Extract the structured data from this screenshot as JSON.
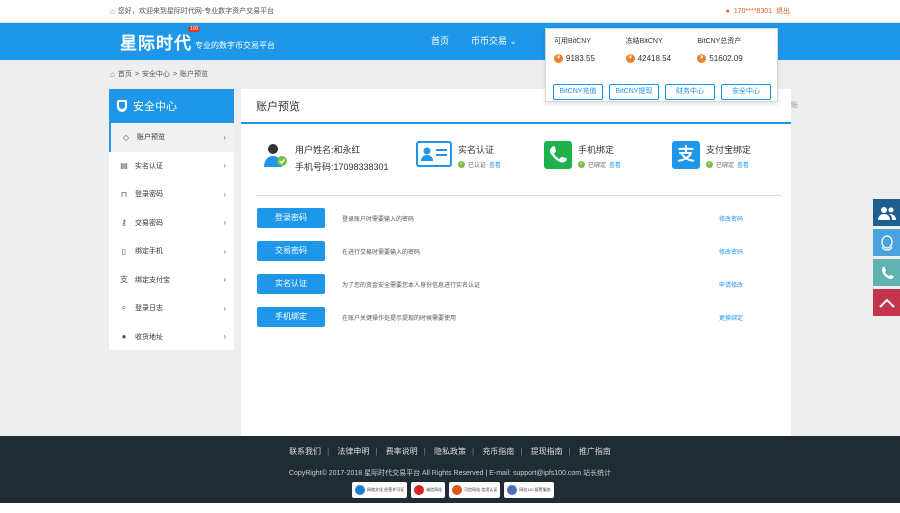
{
  "topbar": {
    "welcome": "您好，欢迎来到星际时代网-专业数字资产交易平台",
    "phone": "170****8301",
    "logout": "退出"
  },
  "header": {
    "logo_name": "星际时代",
    "logo_badge": "100",
    "logo_slogan": "专业的数字币交易平台",
    "nav": [
      {
        "label": "首页"
      },
      {
        "label": "币币交易 ⌄"
      }
    ]
  },
  "balance_dropdown": {
    "columns": [
      {
        "label": "可用BitCNY",
        "value": "9183.55"
      },
      {
        "label": "冻结BitCNY",
        "value": "42418.54"
      },
      {
        "label": "BitCNY总资产",
        "value": "51602.09"
      }
    ],
    "buttons": [
      {
        "label": "BitCNY充值"
      },
      {
        "label": "BitCNY提现"
      },
      {
        "label": "财务中心"
      },
      {
        "label": "安全中心"
      }
    ]
  },
  "breadcrumb": {
    "home": "首页",
    "sep": ">",
    "section": "安全中心",
    "page": "账户预览"
  },
  "sidebar": {
    "title": "安全中心",
    "items": [
      {
        "label": "账户预览",
        "icon": "diamond-icon"
      },
      {
        "label": "实名认证",
        "icon": "id-card-icon"
      },
      {
        "label": "登录密码",
        "icon": "lock-icon"
      },
      {
        "label": "交易密码",
        "icon": "key-icon"
      },
      {
        "label": "绑定手机",
        "icon": "phone-icon"
      },
      {
        "label": "绑定支付宝",
        "icon": "alipay-icon"
      },
      {
        "label": "登录日志",
        "icon": "search-icon"
      },
      {
        "label": "收货地址",
        "icon": "globe-icon"
      }
    ]
  },
  "main": {
    "title": "账户预览",
    "user_name": "用户姓名:和永红",
    "user_phone": "手机号码:17098338301",
    "cards": [
      {
        "title": "实名认证",
        "status": "已认证",
        "view": "查看"
      },
      {
        "title": "手机绑定",
        "status": "已绑定",
        "view": "查看"
      },
      {
        "title": "支付宝绑定",
        "status": "已绑定",
        "view": "查看"
      }
    ],
    "rows": [
      {
        "button": "登录密码",
        "desc": "登录账户时需要输入的密码",
        "link": "修改密码"
      },
      {
        "button": "交易密码",
        "desc": "在进行交易时需要输入的密码",
        "link": "修改密码"
      },
      {
        "button": "实名认证",
        "desc": "为了您的资金安全需要您本人身份信息进行实名认证",
        "link": "申请修改"
      },
      {
        "button": "手机绑定",
        "desc": "在账户关键操作处提示提现的时候需要使用",
        "link": "更换绑定"
      }
    ],
    "edge_text": "账"
  },
  "footer": {
    "links": [
      "联系我们",
      "法律申明",
      "费率说明",
      "隐私政策",
      "充币指南",
      "提现指南",
      "推广指南"
    ],
    "copyright": "CopyRight© 2017-2018 星际时代交易平台 All Rights Reserved | E-mail: support@ipfs100.com 站长统计",
    "badges": [
      {
        "label": "网络文化 经营许可证",
        "color": "#1e7fc9"
      },
      {
        "label": "诚信网站",
        "color": "#d4281f"
      },
      {
        "label": "可信网站 信用认证",
        "color": "#e0561c"
      },
      {
        "label": "网站110 报警服务",
        "color": "#4a6fb3"
      }
    ]
  },
  "float_bar": {
    "items": [
      {
        "icon": "users-icon",
        "color": "#1f5f8f"
      },
      {
        "icon": "qq-icon",
        "color": "#4aa3df"
      },
      {
        "icon": "phone-icon",
        "color": "#5fb3b3"
      },
      {
        "icon": "back-to-top-icon",
        "color": "#c2354d"
      }
    ]
  }
}
